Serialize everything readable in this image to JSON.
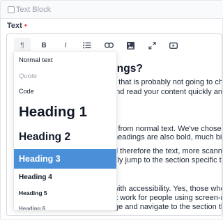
{
  "block": {
    "title": "Text Block"
  },
  "field": {
    "label": "Text",
    "required_marker": "•"
  },
  "toolbar": {
    "paragraph_label": "¶",
    "bold_label": "B",
    "italic_label": "I"
  },
  "content_lines": [
    "dings?",
    "e,\" that is probably not going to cha",
    "and read your content quickly and",
    "y from normal text. We've chosen to",
    "headings are also bold, much bigge",
    "d therefore the text, more scannab",
    "kly jump to the section specific to t",
    "with accessibility. Yes, those who c",
    "'t work for people using screen-rea",
    "ge and navigate to the section that"
  ],
  "dropdown": {
    "items": [
      "Normal text",
      "Quote",
      "Code",
      "Heading 1",
      "Heading 2",
      "Heading 3",
      "Heading 4",
      "Heading 5",
      "Heading 6"
    ],
    "selected": "Heading 3"
  },
  "colors": {
    "accent": "#4a90d9",
    "required": "#ef4444",
    "border": "#d1d5db"
  }
}
